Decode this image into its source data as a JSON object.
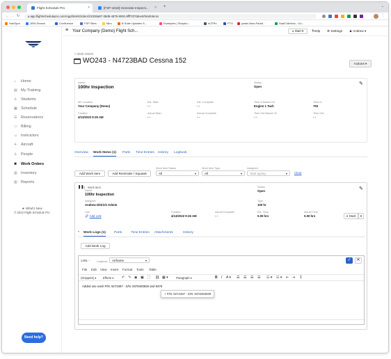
{
  "browser": {
    "tabs": [
      {
        "label": "Flight Schedule Pro"
      },
      {
        "label": "[FSP-1818] Generate Inspecti..."
      }
    ],
    "new_tab": "+",
    "url": "app.flightschedulepro.com/App/WorkOrders/21036a87-38d9-4875-9092-8fff7d70dee0/WorkItems",
    "bookmarks": [
      "HubSpot",
      "JIRA Search",
      "Confluence",
      "FSP Sites",
      "Miro",
      "B Suite Updates S...",
      "Examples | Storybo...",
      "eCFRs",
      "FTG",
      "paste-New-Paddl...",
      "SaaS Metrics - Gu..."
    ]
  },
  "sidebar": {
    "items": [
      {
        "icon": "home-icon",
        "glyph": "⌂",
        "label": "Home"
      },
      {
        "icon": "training-icon",
        "glyph": "▤",
        "label": "My Training"
      },
      {
        "icon": "students-icon",
        "glyph": "♙",
        "label": "Students"
      },
      {
        "icon": "calendar-icon",
        "glyph": "▦",
        "label": "Schedule"
      },
      {
        "icon": "reservations-icon",
        "glyph": "☰",
        "label": "Reservations"
      },
      {
        "icon": "billing-icon",
        "glyph": "▭",
        "label": "Billing"
      },
      {
        "icon": "instructors-icon",
        "glyph": "☺",
        "label": "Instructors"
      },
      {
        "icon": "aircraft-icon",
        "glyph": "✈",
        "label": "Aircraft"
      },
      {
        "icon": "people-icon",
        "glyph": "♙",
        "label": "People"
      },
      {
        "icon": "wrench-icon",
        "glyph": "✖",
        "label": "Work Orders"
      },
      {
        "icon": "inventory-icon",
        "glyph": "▥",
        "label": "Inventory"
      },
      {
        "icon": "reports-icon",
        "glyph": "▥",
        "label": "Reports"
      }
    ],
    "whats_new": "★ What's New",
    "copyright": "© 2022 Flight Schedule Pro",
    "need_help": "Need help?"
  },
  "topbar": {
    "company": "Your Company (Demo) Flight Sch...",
    "start": "Start",
    "help": "Help",
    "settings": "Settings",
    "user": "Andrew"
  },
  "page": {
    "breadcrumb": "< Work Orders",
    "title": "WO243 - N4723BAD Cessna 152",
    "actions": "Actions ▾"
  },
  "summary": {
    "name_label": "Name",
    "name": "100hr Inspection",
    "status_label": "Status",
    "status": "Open",
    "fields": [
      {
        "label": "MX Location",
        "value": "Your Company (Demo)"
      },
      {
        "label": "Est. Start",
        "value": "- -"
      },
      {
        "label": "Est. Complete",
        "value": "- -"
      },
      {
        "label": "Time is Based On",
        "value": "Engine 1 Tach"
      },
      {
        "label": "Time In",
        "value": "793"
      },
      {
        "label": "Created",
        "value": "4/13/2022 9:25 AM"
      },
      {
        "label": "Actual Start",
        "value": "- -"
      },
      {
        "label": "Actual Complete",
        "value": "- -"
      },
      {
        "label": "Time Out Based On",
        "value": "- -"
      },
      {
        "label": "Time Out",
        "value": "- -"
      }
    ]
  },
  "tabs": [
    "Overview",
    "Work Items (1)",
    "Parts",
    "Time Entries",
    "History",
    "Logbook"
  ],
  "filters": {
    "add_work_item": "Add Work Item",
    "add_reminder": "Add Reminder / Squawk",
    "status_label": "Work Item Status",
    "status_value": "All",
    "type_label": "Work Item Type",
    "type_value": "All",
    "assigned_label": "Assigned",
    "assigned_placeholder": "Start typing",
    "clear": "Clear"
  },
  "work_item": {
    "number": "1",
    "type_tag": "Work Item",
    "name_label": "Name",
    "name": "100hr Inspection",
    "status_label": "Status",
    "status": "Open",
    "assignee_label": "Assignee",
    "assignee": "Andrew Dittrich Admin",
    "type_label": "Type",
    "type": "100 hr",
    "link_label": "Link",
    "link": "Add Link",
    "created_label": "Created",
    "created": "4/13/2022 9:26 AM",
    "actual_complete_label": "Actual Complete",
    "actual_complete": "- -",
    "est_time_label": "Est. Time",
    "est_time": "0.00 hrs",
    "actual_time_label": "Actual Time",
    "actual_time": "0.00 hrs",
    "start": "Start",
    "subtabs": [
      "Work Logs (1)",
      "Parts",
      "Time Entries",
      "Attachments",
      "History"
    ],
    "add_work_log": "Add Work Log"
  },
  "editor": {
    "log_prefix": "WL",
    "logbook_label": "Logbook",
    "logbook_value": "Airframe",
    "menu": [
      "File",
      "Edit",
      "View",
      "Insert",
      "Format",
      "Tools",
      "Table"
    ],
    "style_select": "(Snippets)",
    "efforts_select": "Efforts",
    "paragraph_select": "Paragraph",
    "text": "Added one each P/N: 9273497 - S/N: 9378493926 and 9378",
    "suggestion": "+ P/N: 9273497 - S/N: 9378493939"
  }
}
